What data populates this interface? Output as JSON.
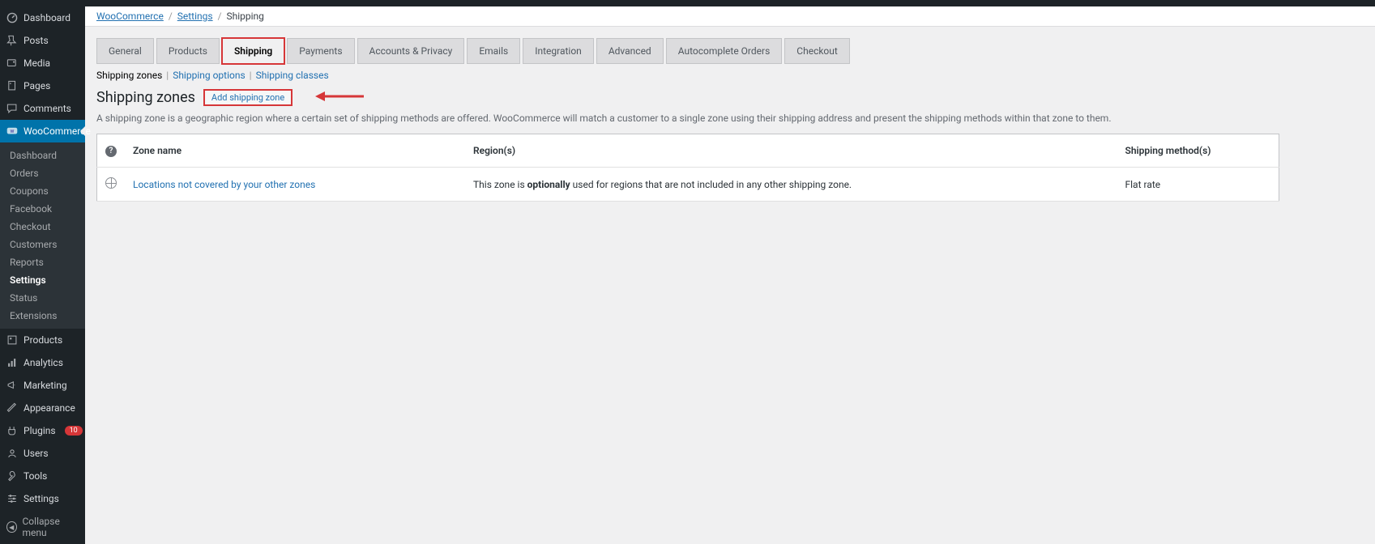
{
  "sidebar": {
    "items": [
      {
        "icon": "dashboard",
        "label": "Dashboard"
      },
      {
        "icon": "pin",
        "label": "Posts"
      },
      {
        "icon": "media",
        "label": "Media"
      },
      {
        "icon": "page",
        "label": "Pages"
      },
      {
        "icon": "comment",
        "label": "Comments"
      },
      {
        "icon": "woo",
        "label": "WooCommerce",
        "active": true
      },
      {
        "icon": "product",
        "label": "Products"
      },
      {
        "icon": "analytics",
        "label": "Analytics"
      },
      {
        "icon": "marketing",
        "label": "Marketing"
      },
      {
        "icon": "brush",
        "label": "Appearance"
      },
      {
        "icon": "plugin",
        "label": "Plugins",
        "badge": "10"
      },
      {
        "icon": "users",
        "label": "Users"
      },
      {
        "icon": "tools",
        "label": "Tools"
      },
      {
        "icon": "settings",
        "label": "Settings"
      }
    ],
    "submenu": [
      "Dashboard",
      "Orders",
      "Coupons",
      "Facebook",
      "Checkout",
      "Customers",
      "Reports",
      "Settings",
      "Status",
      "Extensions"
    ],
    "submenu_active": "Settings",
    "collapse": "Collapse menu"
  },
  "breadcrumb": {
    "parts": [
      "WooCommerce",
      "Settings",
      "Shipping"
    ]
  },
  "tabs": [
    "General",
    "Products",
    "Shipping",
    "Payments",
    "Accounts & Privacy",
    "Emails",
    "Integration",
    "Advanced",
    "Autocomplete Orders",
    "Checkout"
  ],
  "active_tab": "Shipping",
  "sub_tabs": [
    "Shipping zones",
    "Shipping options",
    "Shipping classes"
  ],
  "active_sub_tab": "Shipping zones",
  "heading": "Shipping zones",
  "add_button": "Add shipping zone",
  "description": "A shipping zone is a geographic region where a certain set of shipping methods are offered. WooCommerce will match a customer to a single zone using their shipping address and present the shipping methods within that zone to them.",
  "table": {
    "headers": {
      "zone": "Zone name",
      "region": "Region(s)",
      "method": "Shipping method(s)"
    },
    "rows": [
      {
        "zone_link": "Locations not covered by your other zones",
        "region_pre": "This zone is ",
        "region_bold": "optionally",
        "region_post": " used for regions that are not included in any other shipping zone.",
        "method": "Flat rate"
      }
    ]
  }
}
